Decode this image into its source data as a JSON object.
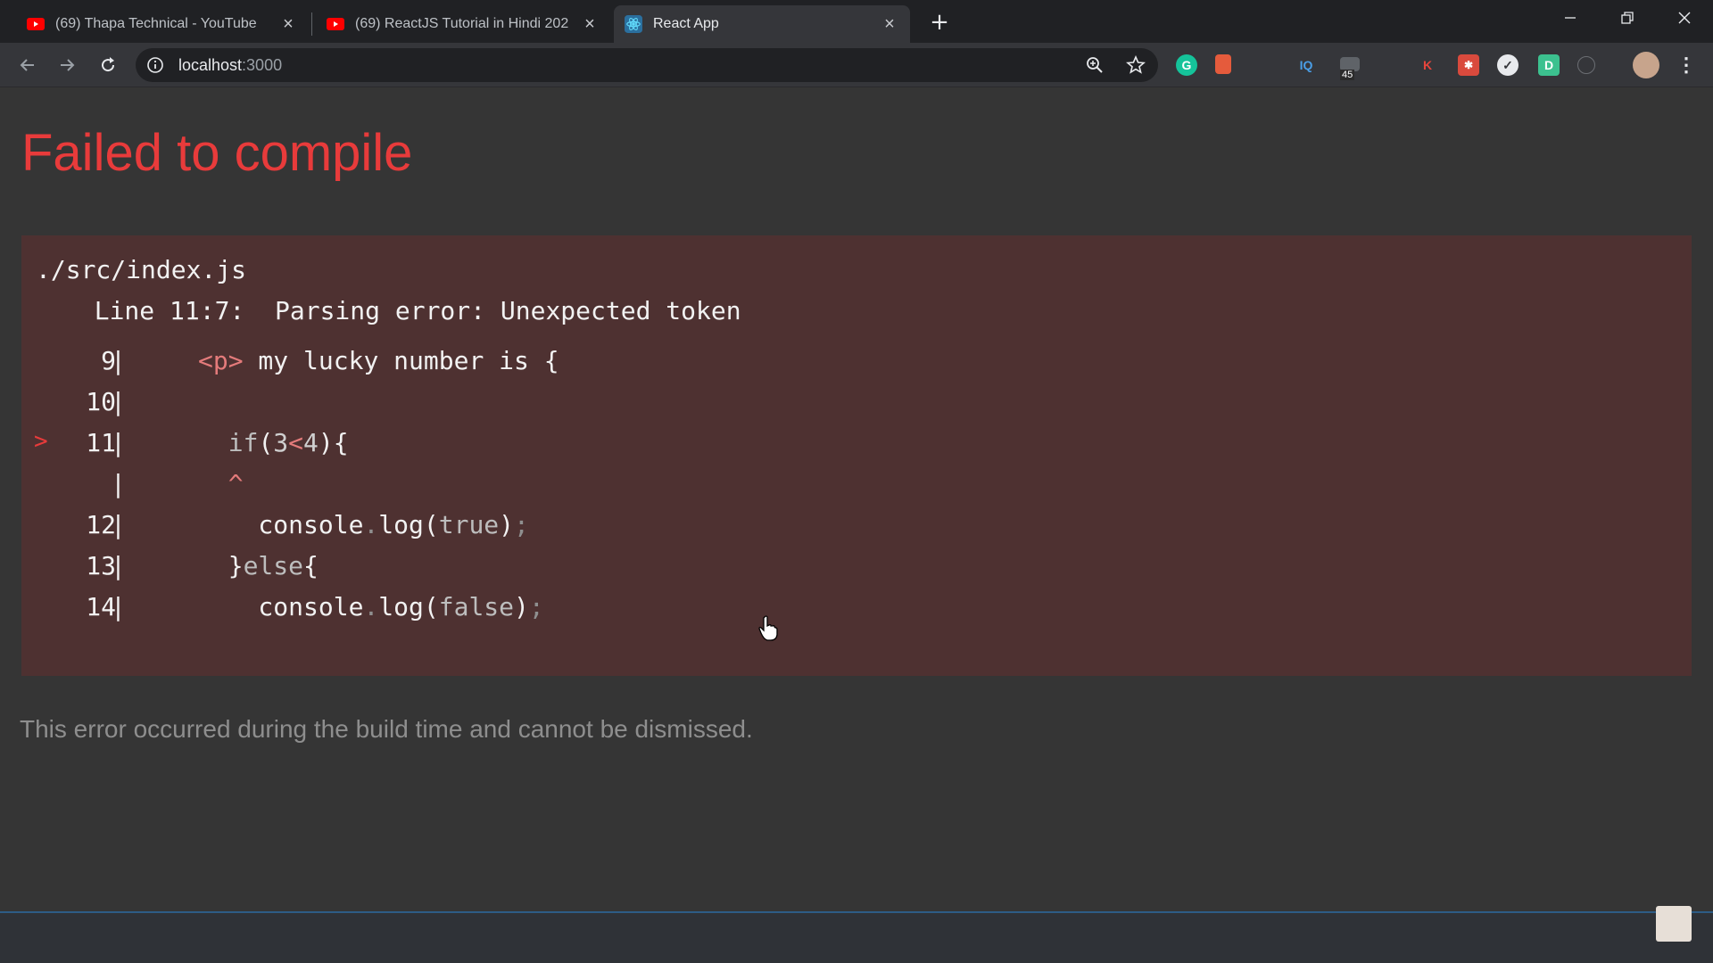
{
  "browser": {
    "tabs": [
      {
        "title": "(69) Thapa Technical - YouTube",
        "favicon": "youtube-icon",
        "active": false
      },
      {
        "title": "(69) ReactJS Tutorial in Hindi 202",
        "favicon": "youtube-icon",
        "active": false
      },
      {
        "title": "React App",
        "favicon": "react-icon",
        "active": true
      }
    ],
    "url_host": "localhost",
    "url_port": ":3000",
    "extension_badge": "45",
    "extensions": [
      "grammarly-icon",
      "bookmark-ext-icon",
      "iq-icon",
      "screen-ext-icon",
      "k-icon",
      "puzzle-ext-icon",
      "check-ext-icon",
      "d-icon",
      "sync-ext-icon"
    ]
  },
  "page": {
    "title": "Failed to compile",
    "file_path": "./src/index.js",
    "error_message": "  Line 11:7:  Parsing error: Unexpected token",
    "code_lines": [
      {
        "num": "9",
        "marker": "",
        "segments": [
          {
            "t": "<p>",
            "c": "tag"
          },
          {
            "t": " my lucky number is {",
            "c": ""
          }
        ]
      },
      {
        "num": "10",
        "marker": "",
        "segments": []
      },
      {
        "num": "11",
        "marker": ">",
        "segments": [
          {
            "t": "  if",
            "c": "kw"
          },
          {
            "t": "(",
            "c": ""
          },
          {
            "t": "3",
            "c": "num"
          },
          {
            "t": "<",
            "c": "op"
          },
          {
            "t": "4",
            "c": "num"
          },
          {
            "t": "){",
            "c": ""
          }
        ]
      },
      {
        "num": "",
        "marker": "",
        "segments": [
          {
            "t": "  ^",
            "c": "caret"
          }
        ]
      },
      {
        "num": "12",
        "marker": "",
        "segments": [
          {
            "t": "    console",
            "c": ""
          },
          {
            "t": ".",
            "c": "punc"
          },
          {
            "t": "log(",
            "c": ""
          },
          {
            "t": "true",
            "c": "kw"
          },
          {
            "t": ")",
            "c": ""
          },
          {
            "t": ";",
            "c": "punc"
          }
        ]
      },
      {
        "num": "13",
        "marker": "",
        "segments": [
          {
            "t": "  }",
            "c": ""
          },
          {
            "t": "else",
            "c": "kw"
          },
          {
            "t": "{",
            "c": ""
          }
        ]
      },
      {
        "num": "14",
        "marker": "",
        "segments": [
          {
            "t": "    console",
            "c": ""
          },
          {
            "t": ".",
            "c": "punc"
          },
          {
            "t": "log(",
            "c": ""
          },
          {
            "t": "false",
            "c": "kw"
          },
          {
            "t": ")",
            "c": ""
          },
          {
            "t": ";",
            "c": "punc"
          }
        ]
      }
    ],
    "footer_message": "This error occurred during the build time and cannot be dismissed."
  },
  "colors": {
    "error_red": "#e83b3b",
    "error_box_bg": "#4e3131",
    "page_bg": "#353535"
  }
}
